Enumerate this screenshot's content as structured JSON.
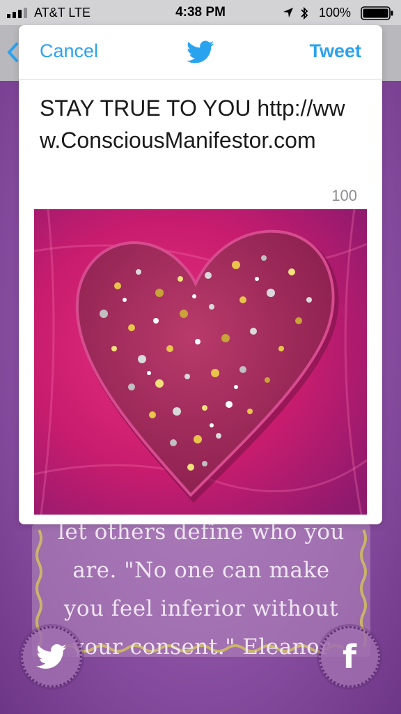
{
  "status_bar": {
    "carrier": "AT&T  LTE",
    "time": "4:38 PM",
    "battery": "100%",
    "icons": [
      "signal-icon",
      "location-icon",
      "bluetooth-icon",
      "battery-icon"
    ]
  },
  "compose": {
    "cancel_label": "Cancel",
    "tweet_label": "Tweet",
    "logo_icon": "twitter-bird-icon",
    "text": "STAY TRUE TO YOU http://www.ConsciousManifestor.com",
    "char_count": "100",
    "image_icon": "glitter-heart-image"
  },
  "background": {
    "quote_lines": [
      "let others define who you",
      "are.  \"No one can make",
      "you feel inferior without",
      "your consent.\"  Eleanor"
    ],
    "share_buttons": [
      "twitter-icon",
      "facebook-icon"
    ]
  },
  "colors": {
    "accent": "#2aa3ef",
    "background_purple": "#8d52a5",
    "heart_pink": "#d8237a",
    "ribbon_gold": "#c9b46a"
  }
}
